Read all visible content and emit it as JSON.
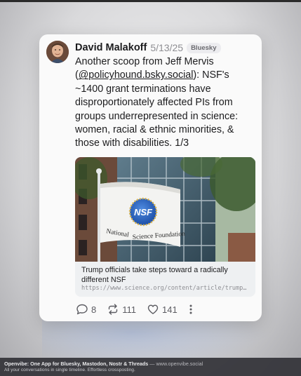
{
  "post": {
    "author_name": "David Malakoff",
    "date": "5/13/25",
    "network": "Bluesky",
    "text_before": "Another scoop from Jeff Mervis (",
    "mention": "@policyhound.bsky.social",
    "text_after": "): NSF's ~1400 grant terminations have disproportionately affected PIs from groups underrepresented in science: women, racial & ethnic minorities, & those with disabilities. 1/3"
  },
  "link_card": {
    "flag_text_line1": "National",
    "flag_text_line2": "Science Foundation",
    "flag_logo": "NSF",
    "title": "Trump officials take steps toward a radically different NSF",
    "url": "https://www.science.org/content/article/trump-officials-take-steps-toward-radically-different-nsf"
  },
  "actions": {
    "replies": "8",
    "reposts": "111",
    "likes": "141"
  },
  "icons": {
    "reply": "speech-bubble-icon",
    "repost": "repost-arrows-icon",
    "like": "heart-icon",
    "more": "vertical-ellipsis-icon"
  },
  "footer": {
    "app_name": "Openvibe: One App for Bluesky, Mastodon, Nostr & Threads",
    "separator": " — ",
    "site": "www.openvibe.social",
    "tagline": "All your conversations in single timeline. Effortless crossposting."
  },
  "colors": {
    "accent_blue": "#1d4fa8",
    "text": "#1c1c1e",
    "muted": "#8e8e93"
  }
}
